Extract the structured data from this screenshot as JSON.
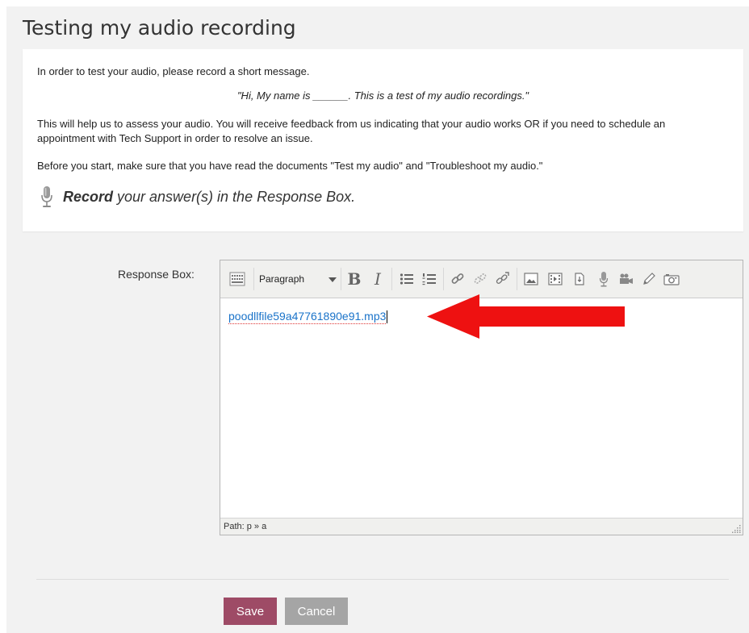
{
  "page": {
    "title": "Testing my audio recording"
  },
  "instructions": {
    "line1": "In order to test your audio, please record a short message.",
    "quote": "\"Hi, My name is ______. This is a test of my audio recordings.\"",
    "line2": "This will help us to assess your audio. You will receive feedback from us indicating that your audio works OR if you need to schedule an appointment with Tech Support in order to resolve an issue.",
    "line3": "Before you start, make sure that you have read the documents \"Test my audio\" and \"Troubleshoot my audio.\"",
    "record_bold": "Record",
    "record_rest": "your answer(s) in the Response Box."
  },
  "response": {
    "label": "Response Box:",
    "toolbar": {
      "format_label": "Paragraph",
      "bold_label": "B",
      "italic_label": "I",
      "icons": [
        "toolbar-toggle-icon",
        "bullet-list-icon",
        "numbered-list-icon",
        "link-icon",
        "unlink-icon",
        "anchor-link-icon",
        "image-icon",
        "media-icon",
        "file-picker-icon",
        "microphone-icon",
        "video-camera-icon",
        "pencil-icon",
        "snapshot-camera-icon"
      ]
    },
    "content_link": "poodllfile59a47761890e91.mp3",
    "path_text": "Path: p » a"
  },
  "buttons": {
    "save": "Save",
    "cancel": "Cancel"
  },
  "colors": {
    "save_bg": "#9e4b66",
    "cancel_bg": "#a5a5a5",
    "link": "#1a73c9",
    "arrow": "#ee1111"
  }
}
